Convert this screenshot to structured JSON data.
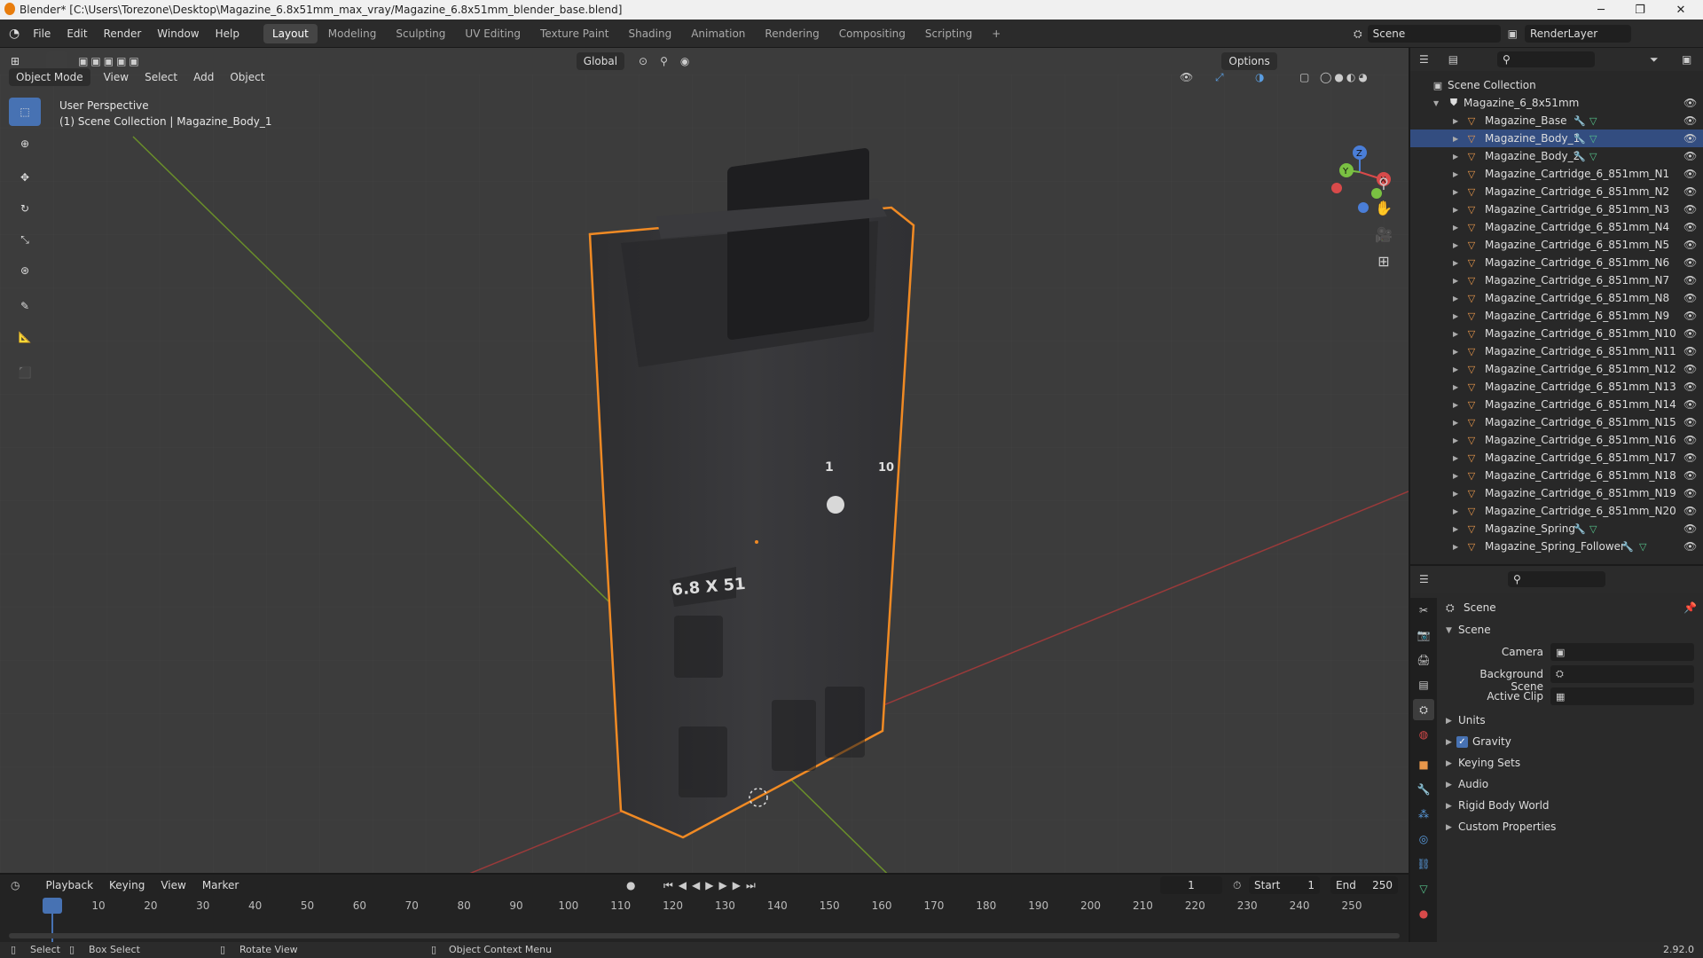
{
  "window": {
    "title": "Blender* [C:\\Users\\Torezone\\Desktop\\Magazine_6.8x51mm_max_vray/Magazine_6.8x51mm_blender_base.blend]",
    "minimize": "─",
    "maximize": "❐",
    "close": "✕"
  },
  "menus": [
    "File",
    "Edit",
    "Render",
    "Window",
    "Help"
  ],
  "workspaces": [
    "Layout",
    "Modeling",
    "Sculpting",
    "UV Editing",
    "Texture Paint",
    "Shading",
    "Animation",
    "Rendering",
    "Compositing",
    "Scripting"
  ],
  "active_workspace": "Layout",
  "add_workspace": "+",
  "scene_name": "Scene",
  "render_layer": "RenderLayer",
  "viewport": {
    "transform_orientation": "Global",
    "options": "Options",
    "mode": "Object Mode",
    "header_menus": [
      "View",
      "Select",
      "Add",
      "Object"
    ],
    "overlay_title": "User Perspective",
    "overlay_sub": "(1) Scene Collection | Magazine_Body_1",
    "gizmo": {
      "x": "X",
      "y": "Y",
      "z": "Z"
    },
    "model_text": {
      "caliber": "6.8 X 51",
      "mark1": "1",
      "mark10": "10"
    }
  },
  "outliner": {
    "root": "Scene Collection",
    "collection": "Magazine_6_8x51mm",
    "items": [
      {
        "name": "Magazine_Base",
        "mod": true,
        "selected": false
      },
      {
        "name": "Magazine_Body_1",
        "mod": true,
        "selected": true
      },
      {
        "name": "Magazine_Body_2",
        "mod": true,
        "selected": false
      },
      {
        "name": "Magazine_Cartridge_6_851mm_N1",
        "mod": false,
        "selected": false
      },
      {
        "name": "Magazine_Cartridge_6_851mm_N2",
        "mod": false,
        "selected": false
      },
      {
        "name": "Magazine_Cartridge_6_851mm_N3",
        "mod": false,
        "selected": false
      },
      {
        "name": "Magazine_Cartridge_6_851mm_N4",
        "mod": false,
        "selected": false
      },
      {
        "name": "Magazine_Cartridge_6_851mm_N5",
        "mod": false,
        "selected": false
      },
      {
        "name": "Magazine_Cartridge_6_851mm_N6",
        "mod": false,
        "selected": false
      },
      {
        "name": "Magazine_Cartridge_6_851mm_N7",
        "mod": false,
        "selected": false
      },
      {
        "name": "Magazine_Cartridge_6_851mm_N8",
        "mod": false,
        "selected": false
      },
      {
        "name": "Magazine_Cartridge_6_851mm_N9",
        "mod": false,
        "selected": false
      },
      {
        "name": "Magazine_Cartridge_6_851mm_N10",
        "mod": false,
        "selected": false
      },
      {
        "name": "Magazine_Cartridge_6_851mm_N11",
        "mod": false,
        "selected": false
      },
      {
        "name": "Magazine_Cartridge_6_851mm_N12",
        "mod": false,
        "selected": false
      },
      {
        "name": "Magazine_Cartridge_6_851mm_N13",
        "mod": false,
        "selected": false
      },
      {
        "name": "Magazine_Cartridge_6_851mm_N14",
        "mod": false,
        "selected": false
      },
      {
        "name": "Magazine_Cartridge_6_851mm_N15",
        "mod": false,
        "selected": false
      },
      {
        "name": "Magazine_Cartridge_6_851mm_N16",
        "mod": false,
        "selected": false
      },
      {
        "name": "Magazine_Cartridge_6_851mm_N17",
        "mod": false,
        "selected": false
      },
      {
        "name": "Magazine_Cartridge_6_851mm_N18",
        "mod": false,
        "selected": false
      },
      {
        "name": "Magazine_Cartridge_6_851mm_N19",
        "mod": false,
        "selected": false
      },
      {
        "name": "Magazine_Cartridge_6_851mm_N20",
        "mod": false,
        "selected": false
      },
      {
        "name": "Magazine_Spring",
        "mod": true,
        "selected": false
      },
      {
        "name": "Magazine_Spring_Follower",
        "mod": true,
        "selected": false
      }
    ]
  },
  "properties": {
    "context": "Scene",
    "section": "Scene",
    "camera_label": "Camera",
    "background_scene_label": "Background Scene",
    "active_clip_label": "Active Clip",
    "panels": [
      "Units",
      "Gravity",
      "Keying Sets",
      "Audio",
      "Rigid Body World",
      "Custom Properties"
    ],
    "gravity_checked": true
  },
  "timeline": {
    "menus": [
      "Playback",
      "Keying",
      "View",
      "Marker"
    ],
    "current_frame": "1",
    "start_label": "Start",
    "start": "1",
    "end_label": "End",
    "end": "250",
    "ticks": [
      "1",
      "10",
      "20",
      "30",
      "40",
      "50",
      "60",
      "70",
      "80",
      "90",
      "100",
      "110",
      "120",
      "130",
      "140",
      "150",
      "160",
      "170",
      "180",
      "190",
      "200",
      "210",
      "220",
      "230",
      "240",
      "250"
    ]
  },
  "statusbar": {
    "select": "Select",
    "box_select": "Box Select",
    "rotate": "Rotate View",
    "context_menu": "Object Context Menu",
    "version": "2.92.0"
  }
}
